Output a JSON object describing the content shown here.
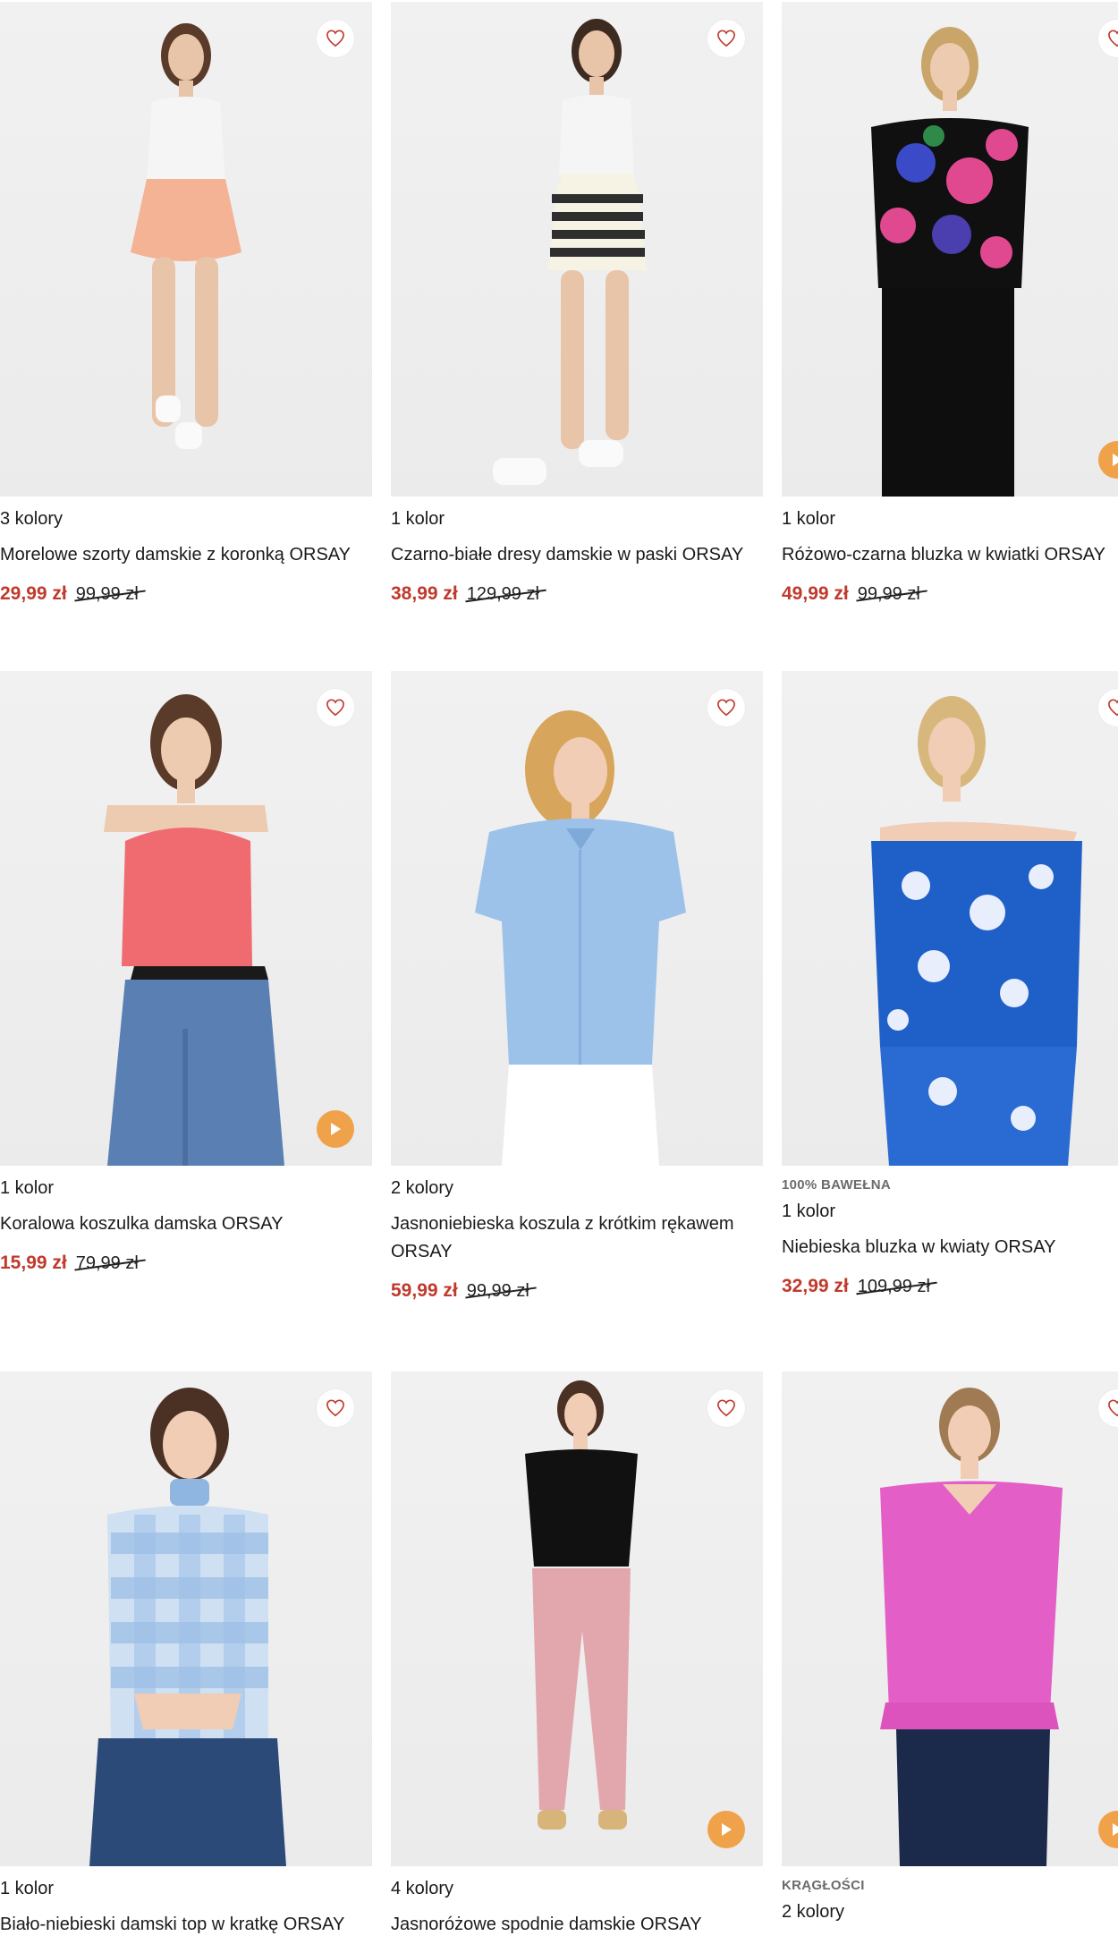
{
  "colors": {
    "sale_price": "#c0392b",
    "play_button": "#f0a24a",
    "heart": "#c0392b",
    "photo_bg": "#eeeeee"
  },
  "products": [
    {
      "colors_label": "3 kolory",
      "name": "Morelowe szorty damskie z koronką ORSAY",
      "price": "29,99 zł",
      "old_price": "99,99 zł",
      "badge": "",
      "has_play": false,
      "icon": "favorite-heart-icon"
    },
    {
      "colors_label": "1 kolor",
      "name": "Czarno-białe dresy damskie w paski ORSAY",
      "price": "38,99 zł",
      "old_price": "129,99 zł",
      "badge": "",
      "has_play": false,
      "icon": "favorite-heart-icon"
    },
    {
      "colors_label": "1 kolor",
      "name": "Różowo-czarna bluzka w kwiatki ORSAY",
      "price": "49,99 zł",
      "old_price": "99,99 zł",
      "badge": "",
      "has_play": true,
      "icon": "favorite-heart-icon"
    },
    {
      "colors_label": "1 kolor",
      "name": "Koralowa koszulka damska ORSAY",
      "price": "15,99 zł",
      "old_price": "79,99 zł",
      "badge": "",
      "has_play": true,
      "icon": "favorite-heart-icon"
    },
    {
      "colors_label": "2 kolory",
      "name": "Jasnoniebieska koszula z krótkim rękawem ORSAY",
      "price": "59,99 zł",
      "old_price": "99,99 zł",
      "badge": "",
      "has_play": false,
      "icon": "favorite-heart-icon"
    },
    {
      "colors_label": "1 kolor",
      "name": "Niebieska bluzka w kwiaty ORSAY",
      "price": "32,99 zł",
      "old_price": "109,99 zł",
      "badge": "100% BAWEŁNA",
      "has_play": false,
      "icon": "favorite-heart-icon"
    },
    {
      "colors_label": "1 kolor",
      "name": "Biało-niebieski damski top w kratkę ORSAY",
      "price": "",
      "old_price": "",
      "badge": "",
      "has_play": false,
      "icon": "favorite-heart-icon"
    },
    {
      "colors_label": "4 kolory",
      "name": "Jasnoróżowe spodnie damskie ORSAY",
      "price": "",
      "old_price": "",
      "badge": "",
      "has_play": true,
      "icon": "favorite-heart-icon"
    },
    {
      "colors_label": "2 kolory",
      "name": "",
      "price": "",
      "old_price": "",
      "badge": "KRĄGŁOŚCI",
      "has_play": true,
      "icon": "favorite-heart-icon"
    }
  ]
}
